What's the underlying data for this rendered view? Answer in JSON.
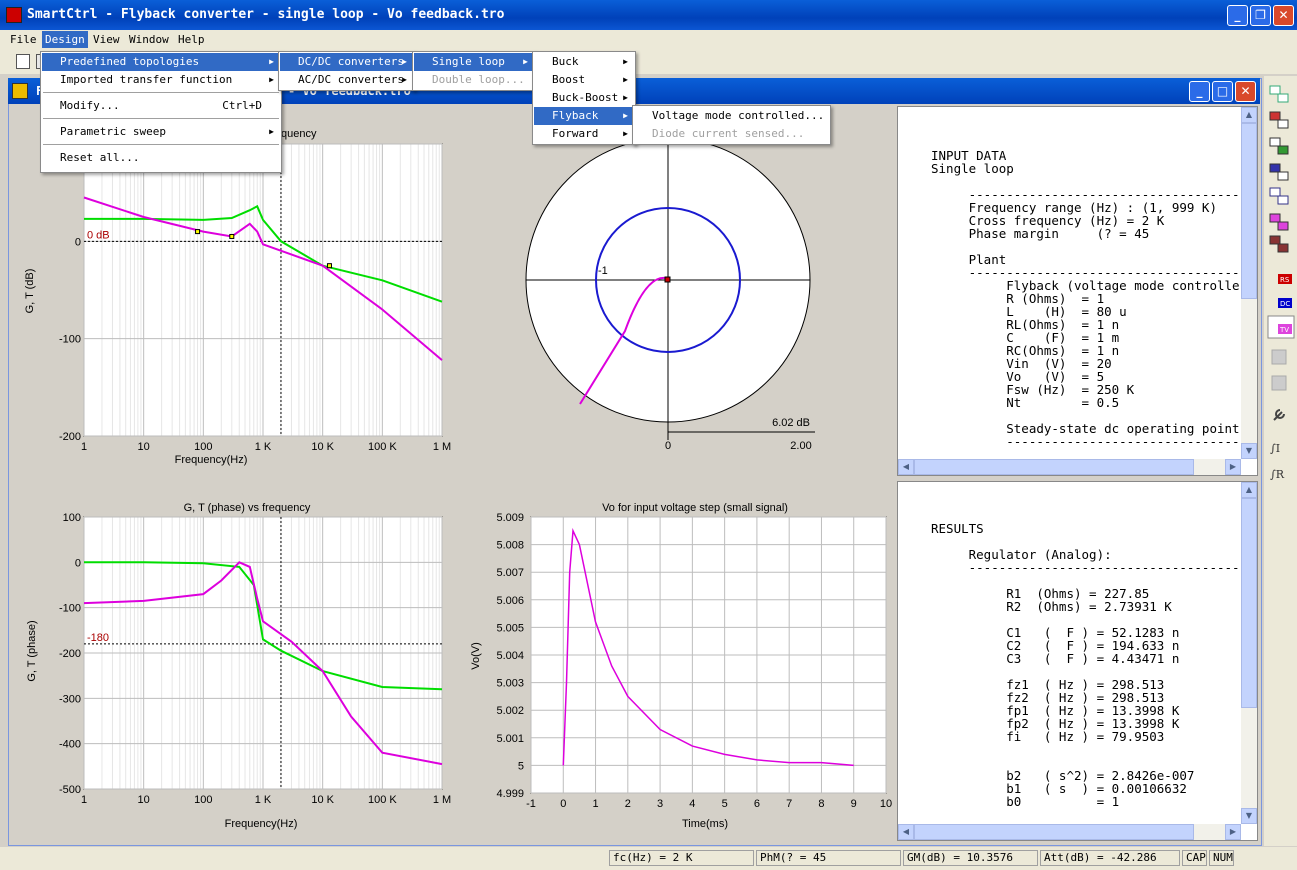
{
  "app": {
    "title": "SmartCtrl - Flyback converter - single loop - Vo feedback.tro"
  },
  "menubar": [
    "File",
    "Design",
    "View",
    "Window",
    "Help"
  ],
  "child": {
    "title": "F",
    "title_tail": "- Vo feedback.tro"
  },
  "menus": {
    "design": [
      {
        "label": "Predefined topologies",
        "submenu": true,
        "highlight": true
      },
      {
        "label": "Imported transfer function",
        "submenu": true
      },
      {
        "sep": true
      },
      {
        "label": "Modify...",
        "shortcut": "Ctrl+D"
      },
      {
        "sep": true
      },
      {
        "label": "Parametric sweep",
        "submenu": true
      },
      {
        "sep": true
      },
      {
        "label": "Reset all..."
      }
    ],
    "predefined": [
      {
        "label": "DC/DC converters",
        "submenu": true,
        "highlight": true
      },
      {
        "label": "AC/DC converters",
        "submenu": true
      }
    ],
    "dcdc": [
      {
        "label": "Single loop",
        "submenu": true,
        "highlight": true
      },
      {
        "label": "Double loop...",
        "disabled": true
      }
    ],
    "single": [
      {
        "label": "Buck",
        "submenu": true
      },
      {
        "label": "Boost",
        "submenu": true
      },
      {
        "label": "Buck-Boost",
        "submenu": true
      },
      {
        "label": "Flyback",
        "submenu": true,
        "highlight": true
      },
      {
        "label": "Forward",
        "submenu": true
      }
    ],
    "flyback": [
      {
        "label": "Voltage mode controlled..."
      },
      {
        "label": "Diode current sensed...",
        "disabled": true
      }
    ]
  },
  "charts": {
    "mag": {
      "title_visible": "quency",
      "ylabel": "G, T (dB)",
      "xlabel": "Frequency(Hz)",
      "ref_label": "0 dB"
    },
    "nyquist": {
      "center_label": "-1",
      "scale_label": "6.02 dB",
      "x0": "0",
      "x1": "2.00"
    },
    "phase": {
      "title": "G, T (phase) vs frequency",
      "ylabel": "G, T (phase)",
      "xlabel": "Frequency(Hz)",
      "ref_label": "-180"
    },
    "step": {
      "title": "Vo for input voltage step (small signal)",
      "ylabel": "Vo(V)",
      "xlabel": "Time(ms)"
    }
  },
  "chart_data": [
    {
      "type": "line",
      "title": "",
      "xlabel": "Frequency(Hz)",
      "ylabel": "G, T (dB)",
      "xscale": "log",
      "xlim": [
        1,
        1000000
      ],
      "ylim": [
        -200,
        100
      ],
      "xticks": [
        "1",
        "10",
        "100",
        "1 K",
        "10 K",
        "100 K",
        "1 M"
      ],
      "yticks": [
        "0",
        "-100",
        "-200"
      ],
      "series": [
        {
          "color": "#00dd00",
          "x": [
            1,
            10,
            100,
            300,
            600,
            800,
            1000,
            2000,
            10000,
            100000,
            1000000
          ],
          "y": [
            23,
            23,
            22,
            24,
            32,
            36,
            22,
            0,
            -25,
            -40,
            -62
          ]
        },
        {
          "color": "#dd00dd",
          "x": [
            1,
            10,
            100,
            300,
            600,
            800,
            1000,
            10000,
            100000,
            1000000
          ],
          "y": [
            45,
            25,
            10,
            5,
            18,
            10,
            -3,
            -25,
            -70,
            -122
          ]
        }
      ]
    },
    {
      "type": "line",
      "title": "G, T (phase) vs frequency",
      "xlabel": "Frequency(Hz)",
      "ylabel": "G, T (phase)",
      "xscale": "log",
      "xlim": [
        1,
        1000000
      ],
      "ylim": [
        -500,
        100
      ],
      "xticks": [
        "1",
        "10",
        "100",
        "1 K",
        "10 K",
        "100 K",
        "1 M"
      ],
      "yticks": [
        "100",
        "0",
        "-100",
        "-200",
        "-300",
        "-400",
        "-500"
      ],
      "series": [
        {
          "color": "#00dd00",
          "x": [
            1,
            10,
            100,
            400,
            700,
            1000,
            2000,
            10000,
            100000,
            1000000
          ],
          "y": [
            0,
            0,
            -2,
            -10,
            -50,
            -170,
            -195,
            -240,
            -275,
            -280
          ]
        },
        {
          "color": "#dd00dd",
          "x": [
            1,
            10,
            100,
            200,
            400,
            600,
            800,
            1000,
            3000,
            10000,
            30000,
            100000,
            1000000
          ],
          "y": [
            -90,
            -85,
            -70,
            -40,
            0,
            -10,
            -80,
            -130,
            -175,
            -240,
            -340,
            -420,
            -445
          ]
        }
      ]
    },
    {
      "type": "line",
      "title": "Vo for input voltage step (small signal)",
      "xlabel": "Time(ms)",
      "ylabel": "Vo(V)",
      "xlim": [
        -1,
        10
      ],
      "ylim": [
        4.999,
        5.009
      ],
      "yticks": [
        "5.009",
        "5.008",
        "5.007",
        "5.006",
        "5.005",
        "5.004",
        "5.003",
        "5.002",
        "5.001",
        "5",
        "4.999"
      ],
      "xticks": [
        "-1",
        "0",
        "1",
        "2",
        "3",
        "4",
        "5",
        "6",
        "7",
        "8",
        "9",
        "10"
      ],
      "series": [
        {
          "color": "#dd00dd",
          "x": [
            0,
            0.1,
            0.2,
            0.3,
            0.5,
            1,
            1.5,
            2,
            3,
            4,
            5,
            6,
            7,
            8,
            9
          ],
          "y": [
            5,
            5.003,
            5.007,
            5.0085,
            5.008,
            5.0052,
            5.0036,
            5.0025,
            5.0013,
            5.0007,
            5.0004,
            5.0002,
            5.0001,
            5.0001,
            5
          ]
        }
      ]
    }
  ],
  "input_text": "INPUT DATA\nSingle loop\n\n     -------------------------------------\n     Frequency range (Hz) : (1, 999 K)\n     Cross frequency (Hz) = 2 K\n     Phase margin     (? = 45\n\n     Plant\n     -------------------------------------\n          Flyback (voltage mode controlle\n          R (Ohms)  = 1\n          L    (H)  = 80 u\n          RL(Ohms)  = 1 n\n          C    (F)  = 1 m\n          RC(Ohms)  = 1 n\n          Vin  (V)  = 20\n          Vo   (V)  = 5\n          Fsw (Hz)  = 250 K\n          Nt        = 0.5\n\n          Steady-state dc operating point\n          --------------------------------",
  "results_text": "RESULTS\n\n     Regulator (Analog):\n     -------------------------------------\n\n          R1  (Ohms) = 227.85\n          R2  (Ohms) = 2.73931 K\n\n          C1   (  F ) = 52.1283 n\n          C2   (  F ) = 194.633 n\n          C3   (  F ) = 4.43471 n\n\n          fz1  ( Hz ) = 298.513\n          fz2  ( Hz ) = 298.513\n          fp1  ( Hz ) = 13.3998 K\n          fp2  ( Hz ) = 13.3998 K\n          fi   ( Hz ) = 79.9503\n\n\n          b2   ( s^2) = 2.8426e-007\n          b1   ( s  ) = 0.00106632\n          b0          = 1",
  "status": {
    "fc": "fc(Hz) = 2 K",
    "pm": "PhM(? = 45",
    "gm": "GM(dB) = 10.3576",
    "att": "Att(dB) = -42.286",
    "cap": "CAP",
    "num": "NUM"
  },
  "right_toolbar_labels": [
    "RS",
    "DC",
    "TV"
  ]
}
